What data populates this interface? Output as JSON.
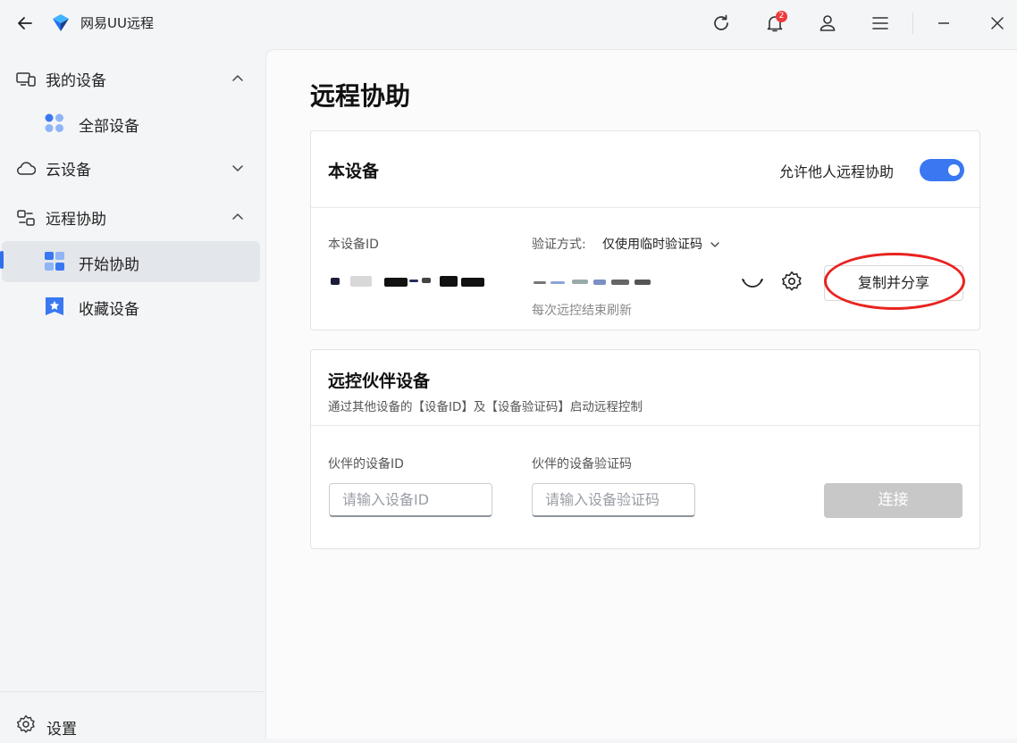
{
  "app": {
    "name": "网易UU远程",
    "notification_count": "2"
  },
  "sidebar": {
    "my_devices": {
      "label": "我的设备"
    },
    "all_devices": {
      "label": "全部设备"
    },
    "cloud_devices": {
      "label": "云设备"
    },
    "remote_assist": {
      "label": "远程协助"
    },
    "start_assist": {
      "label": "开始协助"
    },
    "saved_devices": {
      "label": "收藏设备"
    },
    "settings": {
      "label": "设置"
    }
  },
  "main": {
    "page_title": "远程协助",
    "this_device": {
      "title": "本设备",
      "allow_label": "允许他人远程协助",
      "allow_enabled": true,
      "id_label": "本设备ID",
      "verify_label": "验证方式:",
      "verify_value": "仅使用临时验证码",
      "refresh_hint": "每次远控结束刷新",
      "copy_button": "复制并分享"
    },
    "partner": {
      "title": "远控伙伴设备",
      "description": "通过其他设备的【设备ID】及【设备验证码】启动远程控制",
      "id_label": "伙伴的设备ID",
      "id_placeholder": "请输入设备ID",
      "code_label": "伙伴的设备验证码",
      "code_placeholder": "请输入设备验证码",
      "connect_button": "连接"
    }
  },
  "colors": {
    "accent": "#3a78f2",
    "annotation": "#e8231f",
    "disabled": "#c8c8c8"
  }
}
